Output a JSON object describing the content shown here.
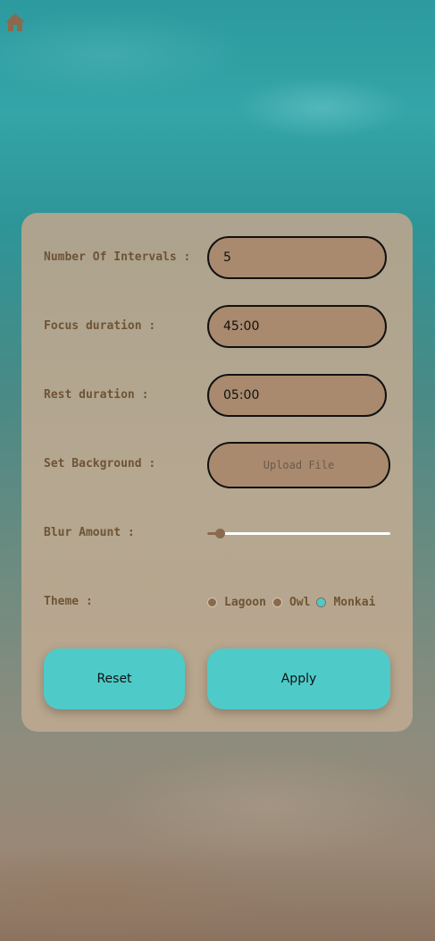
{
  "colors": {
    "label_text": "#6e5435",
    "field_bg": "#a98a6e",
    "button_bg": "#4ecbc9",
    "panel_bg": "#b5a790",
    "home_icon": "#8a6a4e"
  },
  "header": {
    "home_icon": "home-icon"
  },
  "settings": {
    "intervals": {
      "label": "Number Of Intervals :",
      "value": "5"
    },
    "focus": {
      "label": "Focus duration :",
      "value": "45:00"
    },
    "rest": {
      "label": "Rest duration :",
      "value": "05:00"
    },
    "background": {
      "label": "Set Background :",
      "button_label": "Upload File"
    },
    "blur": {
      "label": "Blur Amount :",
      "value_fraction": 0.07
    },
    "theme": {
      "label": "Theme :",
      "options": [
        {
          "label": "Lagoon",
          "selected": false
        },
        {
          "label": "Owl",
          "selected": false
        },
        {
          "label": "Monkai",
          "selected": true
        }
      ]
    }
  },
  "actions": {
    "reset_label": "Reset",
    "apply_label": "Apply"
  }
}
